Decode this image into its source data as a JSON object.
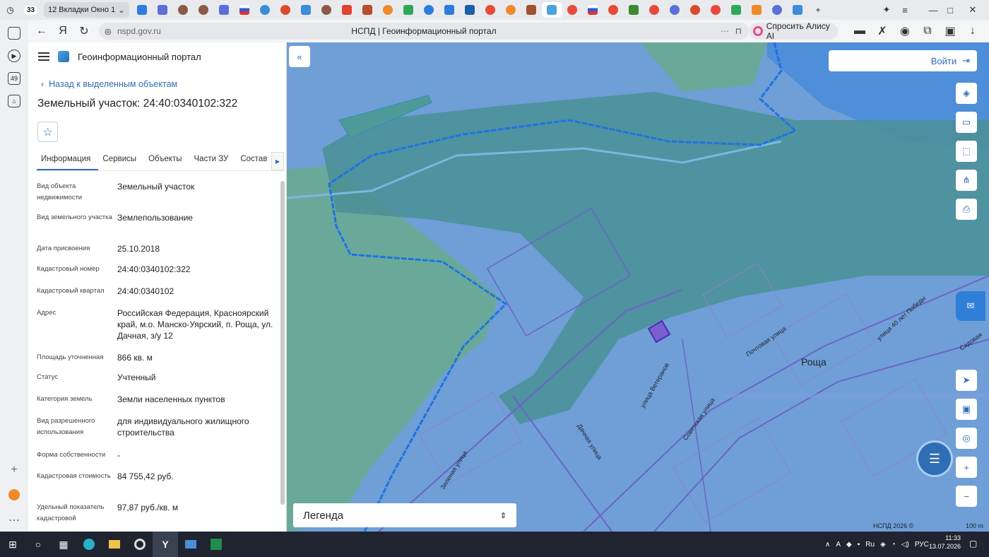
{
  "browser": {
    "tab_count": "33",
    "group_label": "12 Вкладки Окно 1",
    "address": "nspd.gov.ru",
    "page_title": "НСПД | Геоинформационный портал",
    "alice_label": "Спросить Алису AI",
    "sidebar_badge": "49"
  },
  "panel": {
    "portal_title": "Геоинформационный портал",
    "back_label": "Назад к выделенным объектам",
    "title": "Земельный участок: 24:40:0340102:322",
    "tabs": [
      "Информация",
      "Сервисы",
      "Объекты",
      "Части ЗУ",
      "Состав"
    ],
    "properties": [
      {
        "k": "Вид объекта недвижимости",
        "v": "Земельный участок"
      },
      {
        "k": "Вид земельного участка",
        "v": "Землепользование"
      },
      {
        "k": "Дата присвоения",
        "v": "25.10.2018"
      },
      {
        "k": "Кадастровый номер",
        "v": "24:40:0340102:322"
      },
      {
        "k": "Кадастровый квартал",
        "v": "24:40:0340102"
      },
      {
        "k": "Адрес",
        "v": "Российская Федерация, Красноярский край, м.о. Манско-Уярский, п. Роща, ул. Дачная, з/у 12"
      },
      {
        "k": "Площадь уточненная",
        "v": "866 кв. м"
      },
      {
        "k": "Статус",
        "v": "Учтенный"
      },
      {
        "k": "Категория земель",
        "v": "Земли населенных пунктов"
      },
      {
        "k": "Вид разрешенного использования",
        "v": "для индивидуального жилищного строительства"
      },
      {
        "k": "Форма собственности",
        "v": "-"
      },
      {
        "k": "Кадастровая стоимость",
        "v": "84 755,42 руб."
      },
      {
        "k": "Удельный показатель кадастровой",
        "v": "97,87 руб./кв. м"
      }
    ]
  },
  "map": {
    "login_label": "Войти",
    "legend_label": "Легенда",
    "place_label": "Роща",
    "attribution": "НСПД 2026 ©",
    "scale_label": "100 m",
    "street_labels": [
      "Зеленая улица",
      "Дачная улица",
      "улица Ветеранов",
      "Советская улица",
      "Почтовая улица",
      "улица 40 лет Победы",
      "Садовая"
    ]
  },
  "taskbar": {
    "lang": "РУС",
    "time": "11:33",
    "date": "13.07.2026"
  }
}
